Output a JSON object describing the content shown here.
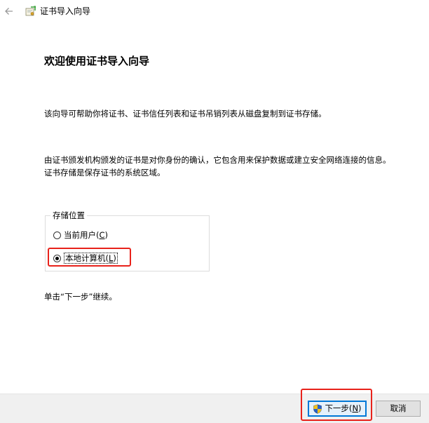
{
  "titlebar": {
    "title": "证书导入向导",
    "back_icon": "arrow-left-icon",
    "app_icon": "certificate-icon"
  },
  "content": {
    "heading": "欢迎使用证书导入向导",
    "intro": "该向导可帮助你将证书、证书信任列表和证书吊销列表从磁盘复制到证书存储。",
    "description": "由证书颁发机构颁发的证书是对你身份的确认，它包含用来保护数据或建立安全网络连接的信息。证书存储是保存证书的系统区域。",
    "store_location": {
      "legend": "存储位置",
      "options": [
        {
          "label": "当前用户(",
          "mnemonic": "C",
          "suffix": ")",
          "selected": false
        },
        {
          "label": "本地计算机(",
          "mnemonic": "L",
          "suffix": ")",
          "selected": true
        }
      ]
    },
    "continue_hint": "单击“下一步”继续。"
  },
  "footer": {
    "next": {
      "label": "下一步(",
      "mnemonic": "N",
      "suffix": ")",
      "icon": "uac-shield-icon"
    },
    "cancel": {
      "label": "取消"
    }
  },
  "colors": {
    "highlight": "#e8221b",
    "default_button_border": "#0078d7",
    "footer_bg": "#f0f0f0"
  }
}
